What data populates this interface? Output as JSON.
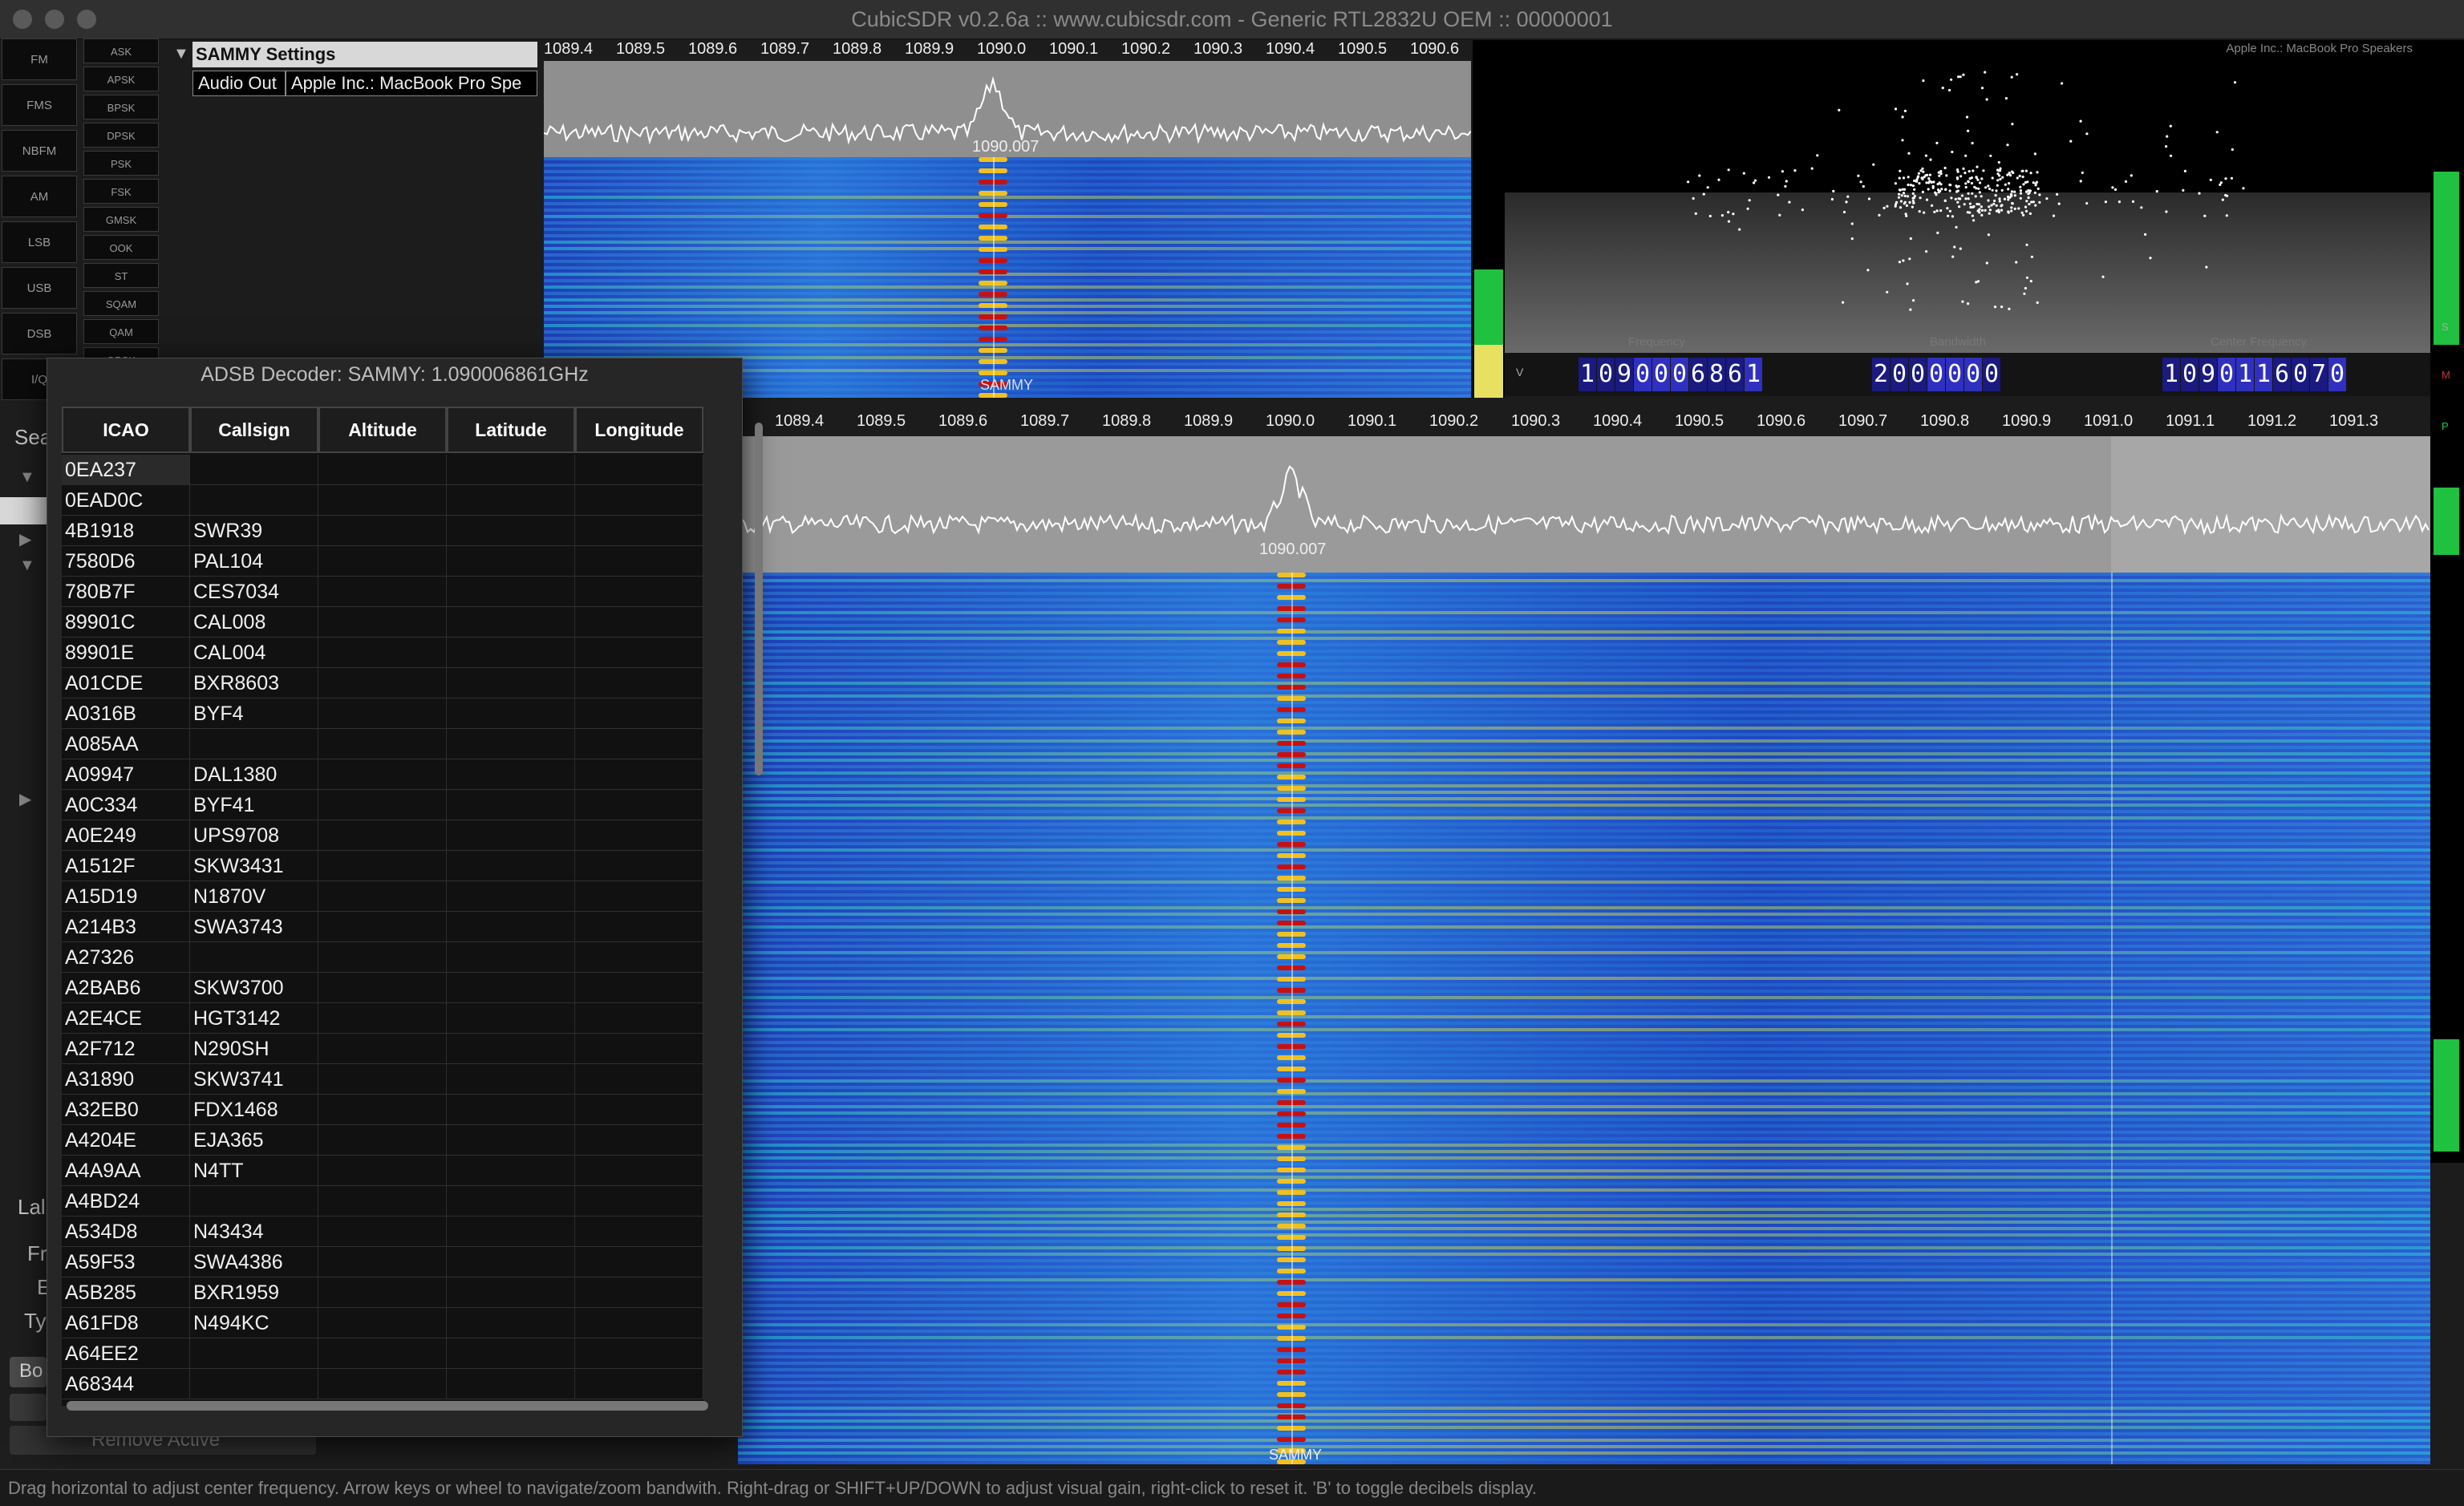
{
  "window": {
    "title": "CubicSDR v0.2.6a :: www.cubicsdr.com - Generic RTL2832U OEM :: 00000001"
  },
  "modes": [
    "FM",
    "FMS",
    "NBFM",
    "AM",
    "LSB",
    "USB",
    "DSB",
    "I/Q"
  ],
  "digital_modes": [
    "ASK",
    "APSK",
    "BPSK",
    "DPSK",
    "PSK",
    "FSK",
    "GMSK",
    "OOK",
    "ST",
    "SQAM",
    "QAM",
    "QPSK"
  ],
  "settings": {
    "title": "SAMMY Settings",
    "audio_out_label": "Audio Out",
    "audio_out_value": "Apple Inc.: MacBook Pro Spe"
  },
  "top_spectrum": {
    "ticks": [
      "1089.4",
      "1089.5",
      "1089.6",
      "1089.7",
      "1089.8",
      "1089.9",
      "1090.0",
      "1090.1",
      "1090.2",
      "1090.3",
      "1090.4",
      "1090.5",
      "1090.6"
    ],
    "center_label": "1090.007",
    "marker_label": "SAMMY"
  },
  "scope": {
    "device_label": "Apple Inc.: MacBook Pro Speakers"
  },
  "readouts": {
    "frequency_label": "Frequency",
    "frequency_digits": [
      "1",
      "0",
      "9",
      "0",
      "0",
      "0",
      "6",
      "8",
      "6",
      "1"
    ],
    "bandwidth_label": "Bandwidth",
    "bandwidth_digits": [
      "2",
      "0",
      "0",
      "0",
      "0",
      "0",
      "0"
    ],
    "center_label": "Center Frequency",
    "center_digits": [
      "1",
      "0",
      "9",
      "0",
      "1",
      "1",
      "6",
      "0",
      "7",
      "0"
    ],
    "v_label": "V",
    "s_label": "S",
    "m_label": "M",
    "p_label": "P"
  },
  "main_spectrum": {
    "ticks": [
      "1089.4",
      "1089.5",
      "1089.6",
      "1089.7",
      "1089.8",
      "1089.9",
      "1090.0",
      "1090.1",
      "1090.2",
      "1090.3",
      "1090.4",
      "1090.5",
      "1090.6",
      "1090.7",
      "1090.8",
      "1090.9",
      "1091.0",
      "1091.1",
      "1091.2",
      "1091.3"
    ],
    "center_label": "1090.007",
    "marker_label": "SAMMY"
  },
  "side_fragments": {
    "sea": "Sea",
    "lal": "Lal",
    "fr": "Fr",
    "e": "E",
    "ty": "Ty",
    "bo": "Bo",
    "remove_active": "Remove Active"
  },
  "adsb": {
    "title": "ADSB Decoder: SAMMY: 1.090006861GHz",
    "columns": [
      "ICAO",
      "Callsign",
      "Altitude",
      "Latitude",
      "Longitude"
    ],
    "rows": [
      [
        "0EA237",
        ""
      ],
      [
        "0EAD0C",
        ""
      ],
      [
        "4B1918",
        "SWR39"
      ],
      [
        "7580D6",
        "PAL104"
      ],
      [
        "780B7F",
        "CES7034"
      ],
      [
        "89901C",
        "CAL008"
      ],
      [
        "89901E",
        "CAL004"
      ],
      [
        "A01CDE",
        "BXR8603"
      ],
      [
        "A0316B",
        "BYF4"
      ],
      [
        "A085AA",
        ""
      ],
      [
        "A09947",
        "DAL1380"
      ],
      [
        "A0C334",
        "BYF41"
      ],
      [
        "A0E249",
        "UPS9708"
      ],
      [
        "A1512F",
        "SKW3431"
      ],
      [
        "A15D19",
        "N1870V"
      ],
      [
        "A214B3",
        "SWA3743"
      ],
      [
        "A27326",
        ""
      ],
      [
        "A2BAB6",
        "SKW3700"
      ],
      [
        "A2E4CE",
        "HGT3142"
      ],
      [
        "A2F712",
        "N290SH"
      ],
      [
        "A31890",
        "SKW3741"
      ],
      [
        "A32EB0",
        "FDX1468"
      ],
      [
        "A4204E",
        "EJA365"
      ],
      [
        "A4A9AA",
        "N4TT"
      ],
      [
        "A4BD24",
        ""
      ],
      [
        "A534D8",
        "N43434"
      ],
      [
        "A59F53",
        "SWA4386"
      ],
      [
        "A5B285",
        "BXR1959"
      ],
      [
        "A61FD8",
        "N494KC"
      ],
      [
        "A64EE2",
        ""
      ],
      [
        "A68344",
        ""
      ]
    ]
  },
  "status_bar": {
    "text": "Drag horizontal to adjust center frequency. Arrow keys or wheel to navigate/zoom bandwith. Right-drag or SHIFT+UP/DOWN to adjust visual gain, right-click to reset it. 'B' to toggle decibels display."
  },
  "colors": {
    "waterfall_base": "#1e40b8",
    "signal_hot": "#c81010",
    "signal_warm": "#f0d020",
    "meter_green": "#20c040",
    "digit_bg": "#3030c0"
  }
}
